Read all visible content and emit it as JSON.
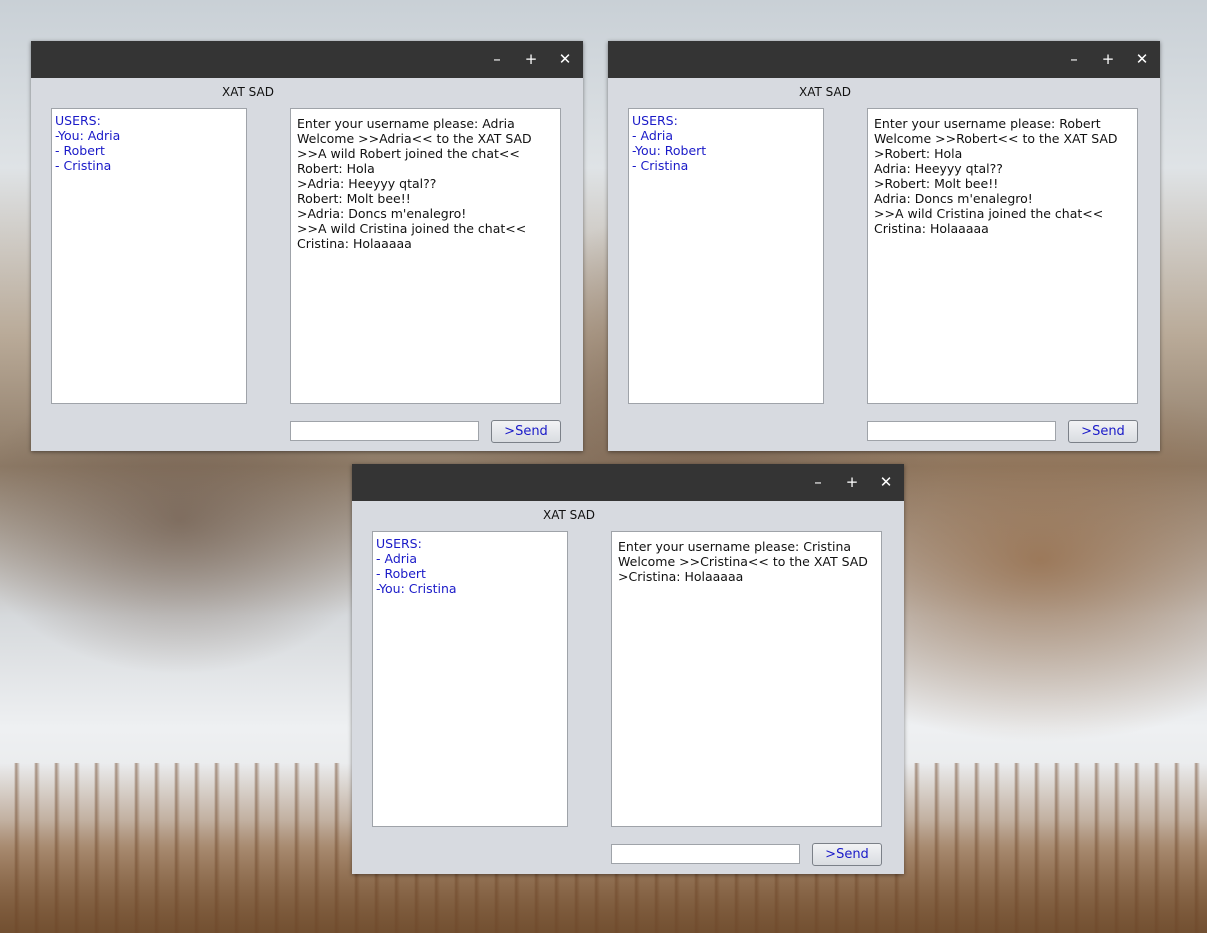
{
  "windows": [
    {
      "title": "XAT SAD",
      "controls": {
        "minimize": "–",
        "maximize": "+",
        "close": "✕"
      },
      "users": [
        "USERS:",
        "-You: Adria",
        "- Robert",
        "- Cristina"
      ],
      "chat": [
        "Enter your username please: Adria",
        "Welcome >>Adria<< to the XAT SAD",
        ">>A wild Robert joined the chat<<",
        "Robert: Hola",
        ">Adria: Heeyyy qtal??",
        "Robert: Molt bee!!",
        ">Adria: Doncs m'enalegro!",
        ">>A wild Cristina joined the chat<<",
        "Cristina: Holaaaaa"
      ],
      "input_value": "",
      "send_label": ">Send"
    },
    {
      "title": "XAT SAD",
      "controls": {
        "minimize": "–",
        "maximize": "+",
        "close": "✕"
      },
      "users": [
        "USERS:",
        "- Adria",
        "-You: Robert",
        "- Cristina"
      ],
      "chat": [
        "Enter your username please: Robert",
        "Welcome >>Robert<< to the XAT SAD",
        ">Robert: Hola",
        "Adria: Heeyyy qtal??",
        ">Robert: Molt bee!!",
        "Adria: Doncs m'enalegro!",
        ">>A wild Cristina joined the chat<<",
        "Cristina: Holaaaaa"
      ],
      "input_value": "",
      "send_label": ">Send"
    },
    {
      "title": "XAT SAD",
      "controls": {
        "minimize": "–",
        "maximize": "+",
        "close": "✕"
      },
      "users": [
        "USERS:",
        "- Adria",
        "- Robert",
        "-You: Cristina"
      ],
      "chat": [
        "Enter your username please: Cristina",
        "Welcome >>Cristina<< to the XAT SAD",
        ">Cristina: Holaaaaa"
      ],
      "input_value": "",
      "send_label": ">Send"
    }
  ]
}
